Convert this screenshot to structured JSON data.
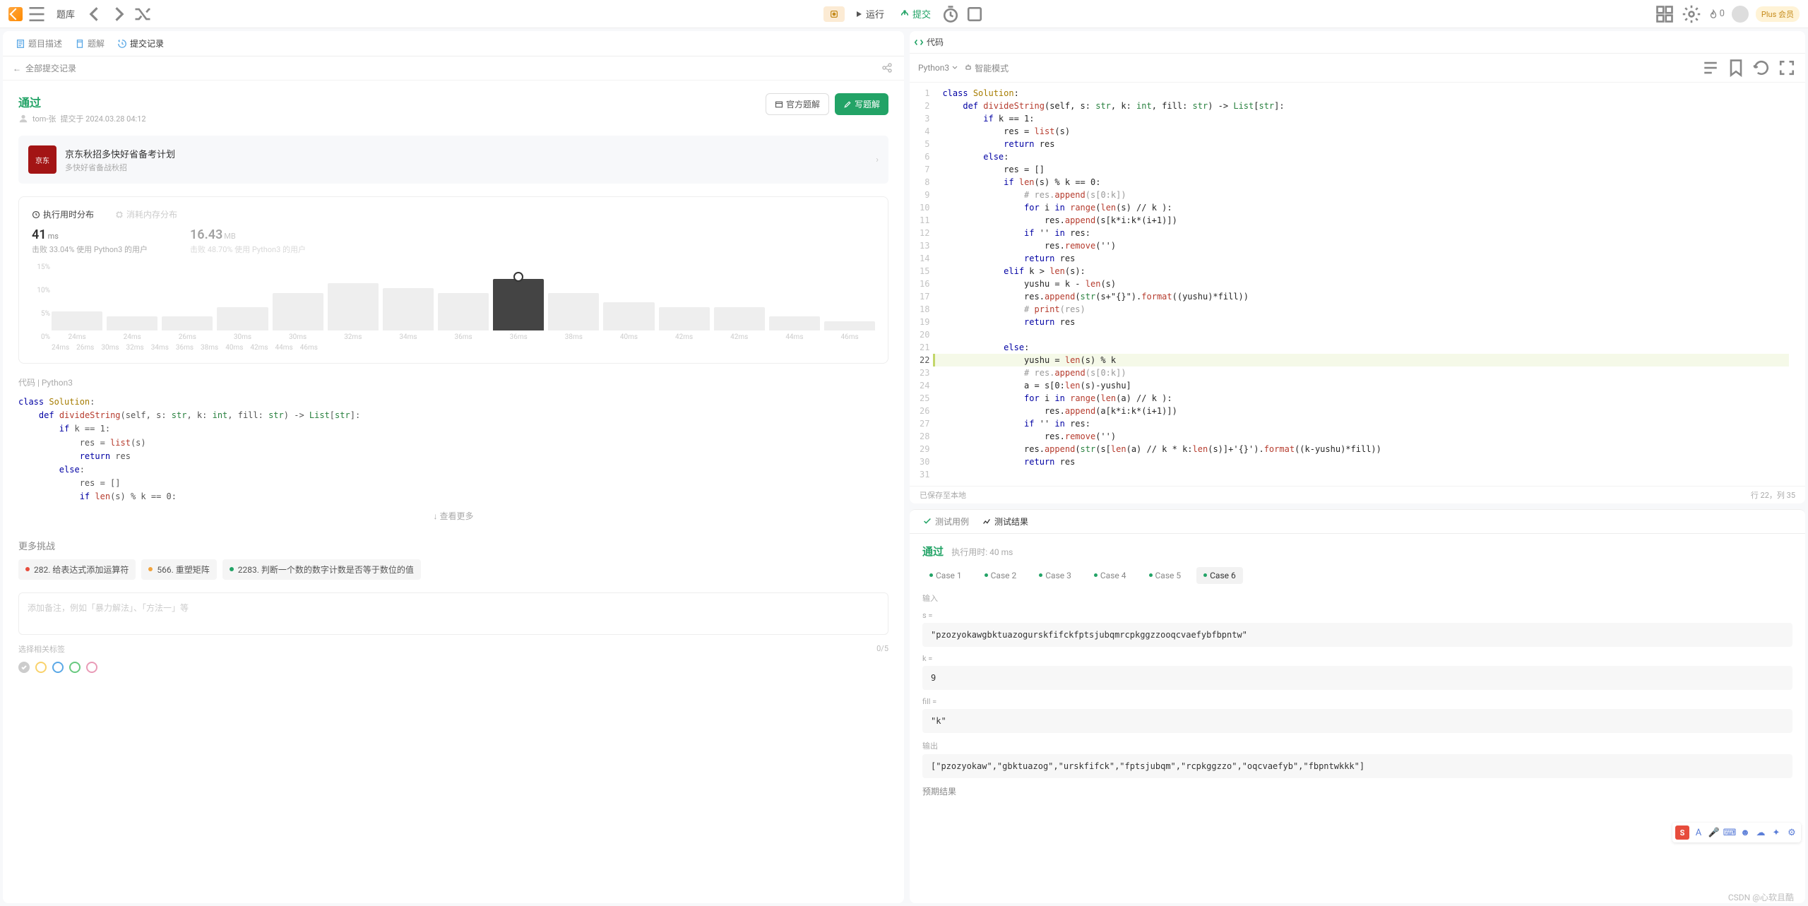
{
  "header": {
    "problem_list": "题库",
    "run": "运行",
    "submit": "提交",
    "fire_count": "0",
    "plus_label": "Plus 会员"
  },
  "left_tabs": {
    "description": "题目描述",
    "solution": "题解",
    "submissions": "提交记录"
  },
  "back_all": "全部提交记录",
  "result": {
    "passed": "通过",
    "user": "tom-张",
    "submitted_at": "提交于 2024.03.28 04:12",
    "official_solution": "官方题解",
    "write_solution": "写题解"
  },
  "promo": {
    "title": "京东秋招多快好省备考计划",
    "sub": "多快好省备战秋招",
    "badge": "京东"
  },
  "stats": {
    "time_tab": "执行用时分布",
    "mem_tab": "消耗内存分布",
    "time_value": "41",
    "time_unit": "ms",
    "time_desc": "击败 33.04% 使用 Python3 的用户",
    "mem_value": "16.43",
    "mem_unit": "MB",
    "mem_desc": "击败 48.70% 使用 Python3 的用户",
    "y_ticks": [
      "15%",
      "10%",
      "5%",
      "0%"
    ]
  },
  "chart_data": {
    "type": "bar",
    "title": "执行用时分布",
    "xlabel": "ms",
    "ylabel": "%",
    "ylim": [
      0,
      15
    ],
    "categories": [
      "24ms",
      "26ms",
      "30ms",
      "32ms",
      "34ms",
      "36ms",
      "38ms",
      "40ms",
      "42ms",
      "44ms",
      "46ms"
    ],
    "values": [
      4,
      3,
      3,
      5,
      8,
      10,
      9,
      8,
      11,
      8,
      6,
      5,
      5,
      3,
      2
    ],
    "highlight_index": 8,
    "legend": [
      "24ms",
      "26ms",
      "30ms",
      "32ms",
      "34ms",
      "36ms",
      "38ms",
      "40ms",
      "42ms",
      "44ms",
      "46ms"
    ]
  },
  "code_header": "代码  |  Python3",
  "code_snippet_lines": [
    "class Solution:",
    "    def divideString(self, s: str, k: int, fill: str) -> List[str]:",
    "        if k == 1:",
    "            res = list(s)",
    "            return res",
    "        else:",
    "            res = []",
    "            if len(s) % k == 0:"
  ],
  "expand_label": "↓ 查看更多",
  "more_challenges": "更多挑战",
  "challenges": [
    {
      "diff": "red",
      "label": "282. 给表达式添加运算符"
    },
    {
      "diff": "orange",
      "label": "566. 重塑矩阵"
    },
    {
      "diff": "green",
      "label": "2283. 判断一个数的数字计数是否等于数位的值"
    }
  ],
  "notes_placeholder": "添加备注，例如「暴力解法」、「方法一」等",
  "tags_placeholder": "选择相关标签",
  "tags_count": "0/5",
  "color_palette": [
    "#bbb",
    "#f9d26b",
    "#5aa8e6",
    "#68c97f",
    "#e99bb7"
  ],
  "code_panel_label": "代码",
  "language": "Python3",
  "smart_mode": "智能模式",
  "editor_lines": [
    "class Solution:",
    "    def divideString(self, s: str, k: int, fill: str) -> List[str]:",
    "        if k == 1:",
    "            res = list(s)",
    "            return res",
    "        else:",
    "            res = []",
    "            if len(s) % k == 0:",
    "                # res.append(s[0:k])",
    "                for i in range(len(s) // k ):",
    "                    res.append(s[k*i:k*(i+1)])",
    "                if '' in res:",
    "                    res.remove('')",
    "                return res",
    "            elif k > len(s):",
    "                yushu = k - len(s)",
    "                res.append(str(s+\"{}\").format((yushu)*fill))",
    "                # print(res)",
    "                return res",
    "",
    "            else:",
    "                yushu = len(s) % k",
    "                # res.append(s[0:k])",
    "                a = s[0:len(s)-yushu]",
    "                for i in range(len(a) // k ):",
    "                    res.append(a[k*i:k*(i+1)])",
    "                if '' in res:",
    "                    res.remove('')",
    "                res.append(str(s[len(a) // k * k:len(s)]+'{}').format((k-yushu)*fill))",
    "                return res",
    ""
  ],
  "editor_highlight_line": 22,
  "autosave": "已保存至本地",
  "cursor": "行 22，列 35",
  "test_tabs": {
    "cases": "测试用例",
    "results": "测试结果"
  },
  "test_result": {
    "passed": "通过",
    "time": "执行用时: 40 ms"
  },
  "cases": [
    "Case 1",
    "Case 2",
    "Case 3",
    "Case 4",
    "Case 5",
    "Case 6"
  ],
  "active_case": 5,
  "input_label": "输入",
  "output_label": "输出",
  "expected_label": "预期结果",
  "fields": {
    "s_label": "s =",
    "s_value": "\"pzozyokawgbktuazogurskfifckfptsjubqmrcpkggzzooqcvaefybfbpntw\"",
    "k_label": "k =",
    "k_value": "9",
    "fill_label": "fill =",
    "fill_value": "\"k\"",
    "output_value": "[\"pzozyokaw\",\"gbktuazog\",\"urskfifck\",\"fptsjubqm\",\"rcpkggzzo\",\"oqcvaefyb\",\"fbpntwkkk\"]"
  },
  "watermark": "CSDN @心软且酷"
}
